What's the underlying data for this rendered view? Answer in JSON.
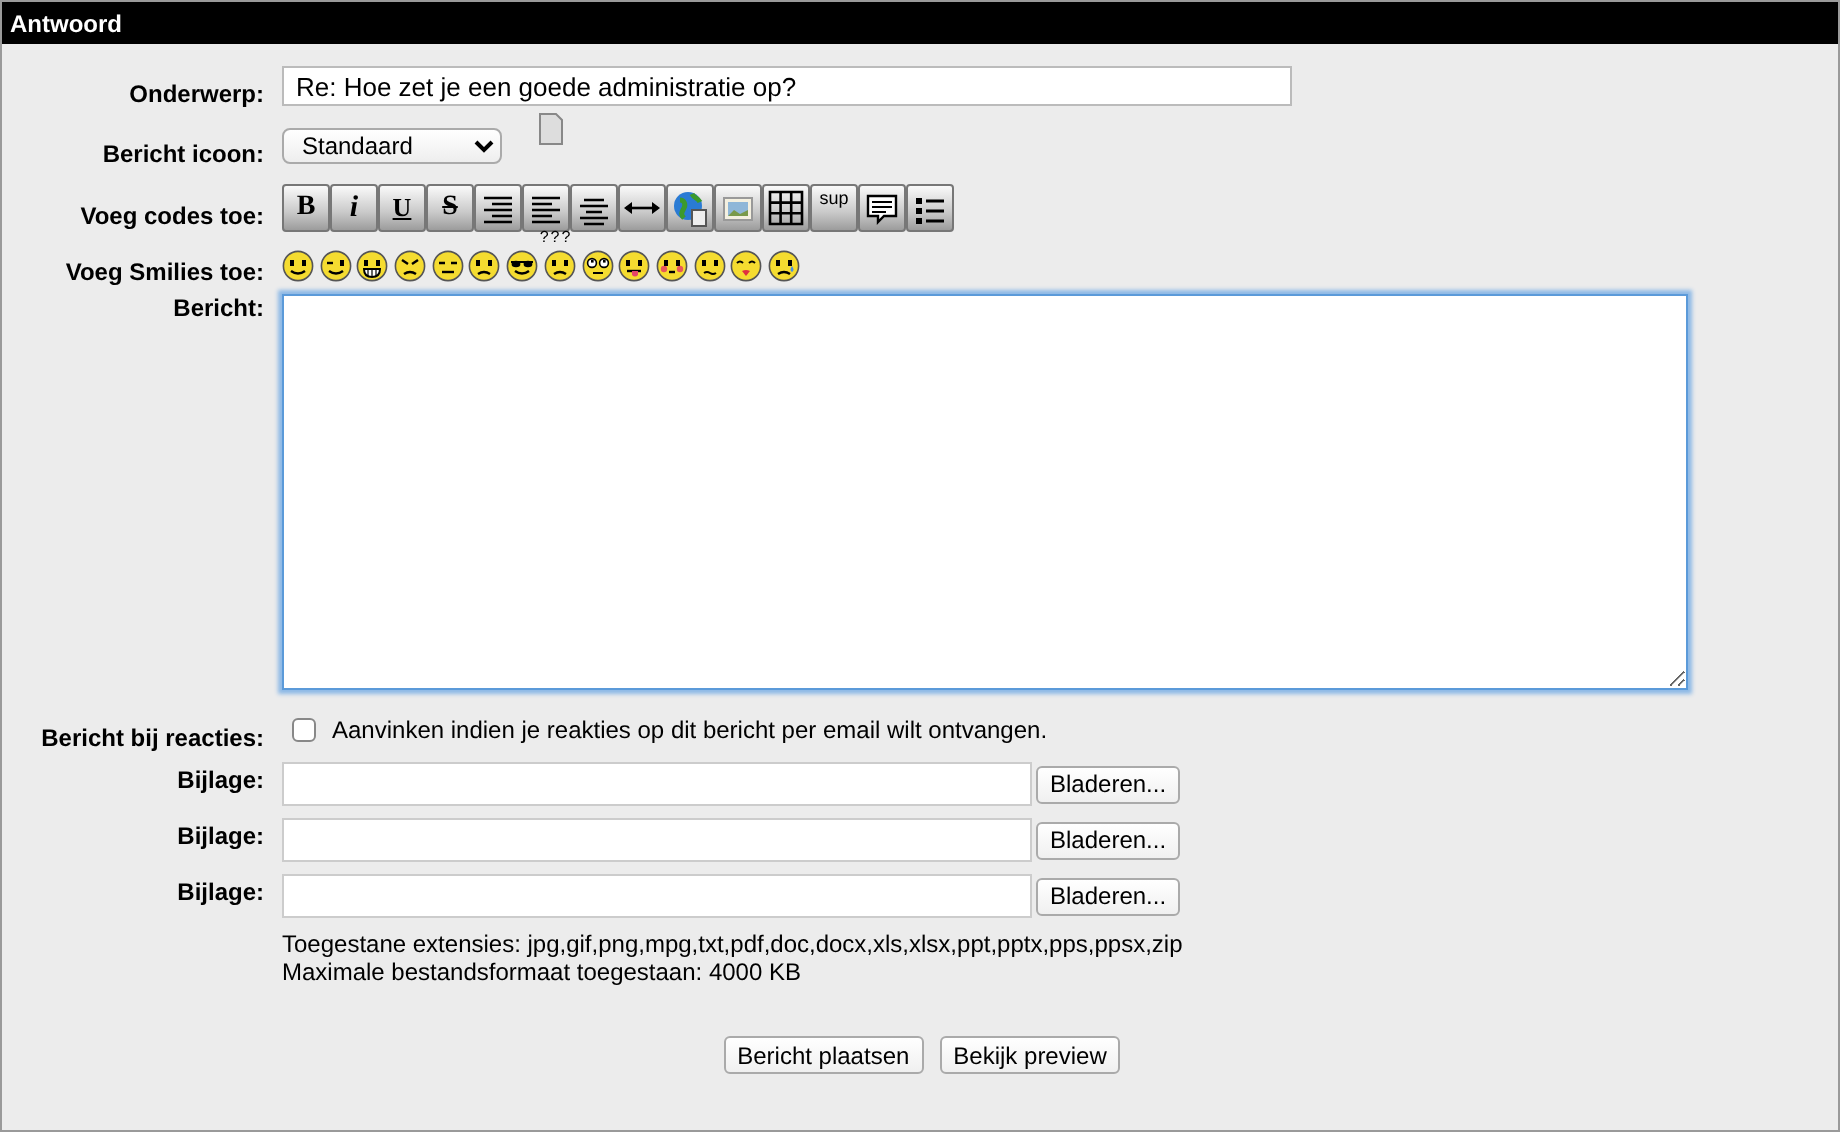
{
  "panel": {
    "title": "Antwoord"
  },
  "subject": {
    "label": "Onderwerp:",
    "value": "Re: Hoe zet je een goede administratie op?"
  },
  "message_icon": {
    "label": "Bericht icoon:",
    "value": "Standaard"
  },
  "codes": {
    "label": "Voeg codes toe:",
    "buttons": [
      {
        "kind": "bold",
        "label": "B"
      },
      {
        "kind": "italic",
        "label": "i"
      },
      {
        "kind": "underline",
        "label": "U"
      },
      {
        "kind": "strike",
        "label": "S"
      },
      {
        "kind": "align-right"
      },
      {
        "kind": "align-left"
      },
      {
        "kind": "center"
      },
      {
        "kind": "rule"
      },
      {
        "kind": "link"
      },
      {
        "kind": "image"
      },
      {
        "kind": "table"
      },
      {
        "kind": "sup",
        "label": "sup"
      },
      {
        "kind": "quote"
      },
      {
        "kind": "list"
      }
    ]
  },
  "smilies": {
    "label": "Voeg Smilies toe:",
    "items": [
      {
        "kind": "smile"
      },
      {
        "kind": "wink"
      },
      {
        "kind": "grin"
      },
      {
        "kind": "angry"
      },
      {
        "kind": "smirk"
      },
      {
        "kind": "sad"
      },
      {
        "kind": "cool"
      },
      {
        "kind": "confused",
        "caption": "???"
      },
      {
        "kind": "rolleyes"
      },
      {
        "kind": "tongue"
      },
      {
        "kind": "blush"
      },
      {
        "kind": "worried"
      },
      {
        "kind": "kiss"
      },
      {
        "kind": "cry"
      }
    ]
  },
  "message": {
    "label": "Bericht:",
    "focused": true
  },
  "notify": {
    "label": "Bericht bij reacties:",
    "text": "Aanvinken indien je reakties op dit bericht per email wilt ontvangen.",
    "checked": false
  },
  "attachments": [
    {
      "label": "Bijlage:",
      "button": "Bladeren..."
    },
    {
      "label": "Bijlage:",
      "button": "Bladeren..."
    },
    {
      "label": "Bijlage:",
      "button": "Bladeren..."
    }
  ],
  "info": [
    "Toegestane extensies: jpg,gif,png,mpg,txt,pdf,doc,docx,xls,xlsx,ppt,pptx,pps,ppsx,zip",
    "Maximale bestandsformaat toegestaan: 4000 KB"
  ],
  "actions": [
    "Bericht plaatsen",
    "Bekijk preview"
  ]
}
